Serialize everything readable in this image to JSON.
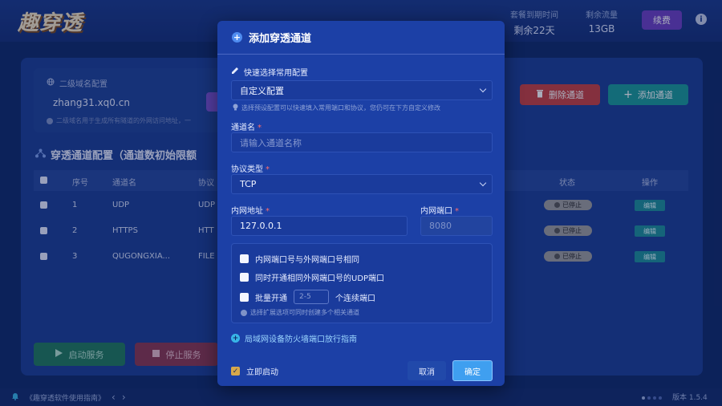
{
  "app": {
    "logo": "趣穿透",
    "stats": [
      {
        "label": "套餐到期时间",
        "value": "剩余22天"
      },
      {
        "label": "剩余流量",
        "value": "13GB"
      }
    ],
    "renew_label": "续费",
    "info_icon": "info-icon"
  },
  "subdomain": {
    "title": "二级域名配置",
    "value": "zhang31.xq0.cn",
    "hint": "二级域名用于生成所有隧道的外网访问地址，一"
  },
  "toolbar": {
    "delete_label": "删除通道",
    "add_label": "添加通道"
  },
  "tunnels": {
    "section_title": "穿透通道配置（通道数初始限额",
    "columns": [
      "序号",
      "通道名",
      "协议",
      "状态",
      "操作"
    ],
    "rows": [
      {
        "index": "1",
        "name": "UDP",
        "protocol": "UDP",
        "status": "已停止",
        "action": "编辑"
      },
      {
        "index": "2",
        "name": "HTTPS",
        "protocol": "HTT",
        "status": "已停止",
        "action": "编辑"
      },
      {
        "index": "3",
        "name": "QUGONGXIA...",
        "protocol": "FILE",
        "status": "已停止",
        "action": "编辑"
      }
    ]
  },
  "service": {
    "start_label": "启动服务",
    "stop_label": "停止服务"
  },
  "footer": {
    "guide": "《趣穿透软件使用指南》",
    "prev": "‹",
    "next": "›",
    "version": "版本 1.5.4"
  },
  "modal": {
    "title": "添加穿透通道",
    "quick_label": "快速选择常用配置",
    "quick_value": "自定义配置",
    "quick_hint": "选择预设配置可以快速填入常用端口和协议，您仍可在下方自定义修改",
    "name_label": "通道名",
    "name_placeholder": "请输入通道名称",
    "protocol_label": "协议类型",
    "protocol_value": "TCP",
    "local_addr_label": "内网地址",
    "local_addr_value": "127.0.0.1",
    "local_port_label": "内网端口",
    "local_port_value": "8080",
    "opt_same_port": "内网端口号与外网端口号相同",
    "opt_udp": "同时开通相同外网端口号的UDP端口",
    "opt_batch_prefix": "批量开通",
    "opt_batch_placeholder": "2-5",
    "opt_batch_suffix": "个连续端口",
    "opt_hint": "选择扩展选项可同时创建多个相关通道",
    "guide_link": "局域网设备防火墙端口放行指南",
    "autostart_label": "立即启动",
    "cancel_label": "取消",
    "ok_label": "确定",
    "required_mark": "*"
  }
}
